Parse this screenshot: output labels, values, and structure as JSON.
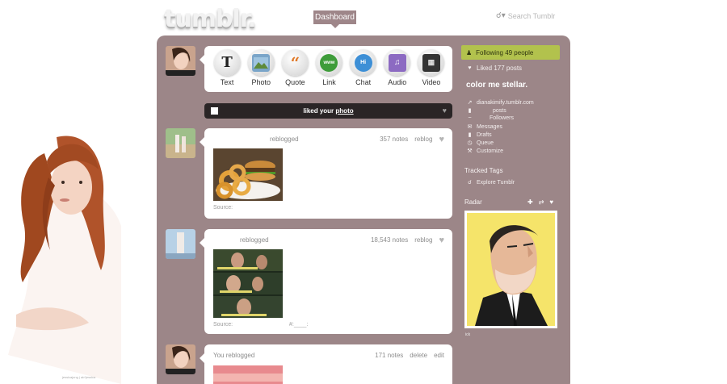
{
  "header": {
    "logo": "tumblr.",
    "dashboard_tab": "Dashboard",
    "search_placeholder": "Search Tumblr"
  },
  "post_types": [
    "Text",
    "Photo",
    "Quote",
    "Link",
    "Chat",
    "Audio",
    "Video"
  ],
  "notification": {
    "text": "liked your",
    "link": "photo"
  },
  "posts": [
    {
      "who": "reblogged",
      "notes": "357 notes",
      "action": "reblog",
      "source": "Source:"
    },
    {
      "who": "reblogged",
      "notes": "18,543 notes",
      "action": "reblog",
      "source": "Source:",
      "tag": "#:____:"
    },
    {
      "who": "You reblogged",
      "notes": "171 notes",
      "action": "delete",
      "action2": "edit"
    }
  ],
  "sidebar": {
    "following": "Following 49 people",
    "liked": "Liked 177 posts",
    "blog_name": "color me stellar.",
    "links": [
      "dianakimify.tumblr.com",
      "posts",
      "Followers",
      "Messages",
      "Drafts",
      "Queue",
      "Customize"
    ],
    "tracked_title": "Tracked Tags",
    "explore": "Explore Tumblr",
    "radar_title": "Radar",
    "radar_caption": "ick"
  },
  "credit": "jessicajung | ab*jessica",
  "colors": {
    "panel": "#9c8688",
    "follow_bar": "#b2c24d",
    "dashboard_tab": "#9e8689"
  }
}
